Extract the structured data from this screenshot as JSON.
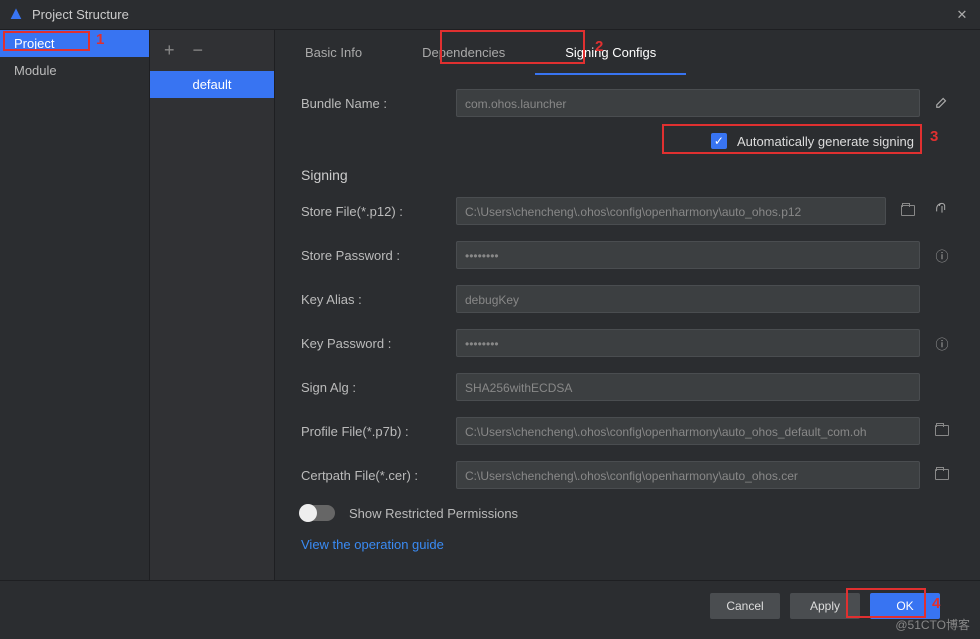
{
  "window": {
    "title": "Project Structure"
  },
  "sidebar": {
    "items": [
      {
        "label": "Project",
        "active": true
      },
      {
        "label": "Module",
        "active": false
      }
    ]
  },
  "configList": {
    "items": [
      {
        "label": "default",
        "active": true
      }
    ]
  },
  "tabs": [
    {
      "label": "Basic Info",
      "active": false
    },
    {
      "label": "Dependencies",
      "active": false
    },
    {
      "label": "Signing Configs",
      "active": true
    }
  ],
  "form": {
    "bundleName": {
      "label": "Bundle Name :",
      "value": "com.ohos.launcher"
    },
    "autoSign": {
      "label": "Automatically generate signing",
      "checked": true
    },
    "section": "Signing",
    "storeFile": {
      "label": "Store File(*.p12) :",
      "value": "C:\\Users\\chencheng\\.ohos\\config\\openharmony\\auto_ohos.p12"
    },
    "storePassword": {
      "label": "Store Password :",
      "value": "••••••••"
    },
    "keyAlias": {
      "label": "Key Alias :",
      "value": "debugKey"
    },
    "keyPassword": {
      "label": "Key Password :",
      "value": "••••••••"
    },
    "signAlg": {
      "label": "Sign Alg :",
      "value": "SHA256withECDSA"
    },
    "profileFile": {
      "label": "Profile File(*.p7b) :",
      "value": "C:\\Users\\chencheng\\.ohos\\config\\openharmony\\auto_ohos_default_com.oh"
    },
    "certpathFile": {
      "label": "Certpath File(*.cer) :",
      "value": "C:\\Users\\chencheng\\.ohos\\config\\openharmony\\auto_ohos.cer"
    },
    "restricted": "Show Restricted Permissions",
    "guideLink": "View the operation guide"
  },
  "buttons": {
    "cancel": "Cancel",
    "apply": "Apply",
    "ok": "OK"
  },
  "annotations": {
    "n1": "1",
    "n2": "2",
    "n3": "3",
    "n4": "4"
  },
  "watermark": "@51CTO博客"
}
